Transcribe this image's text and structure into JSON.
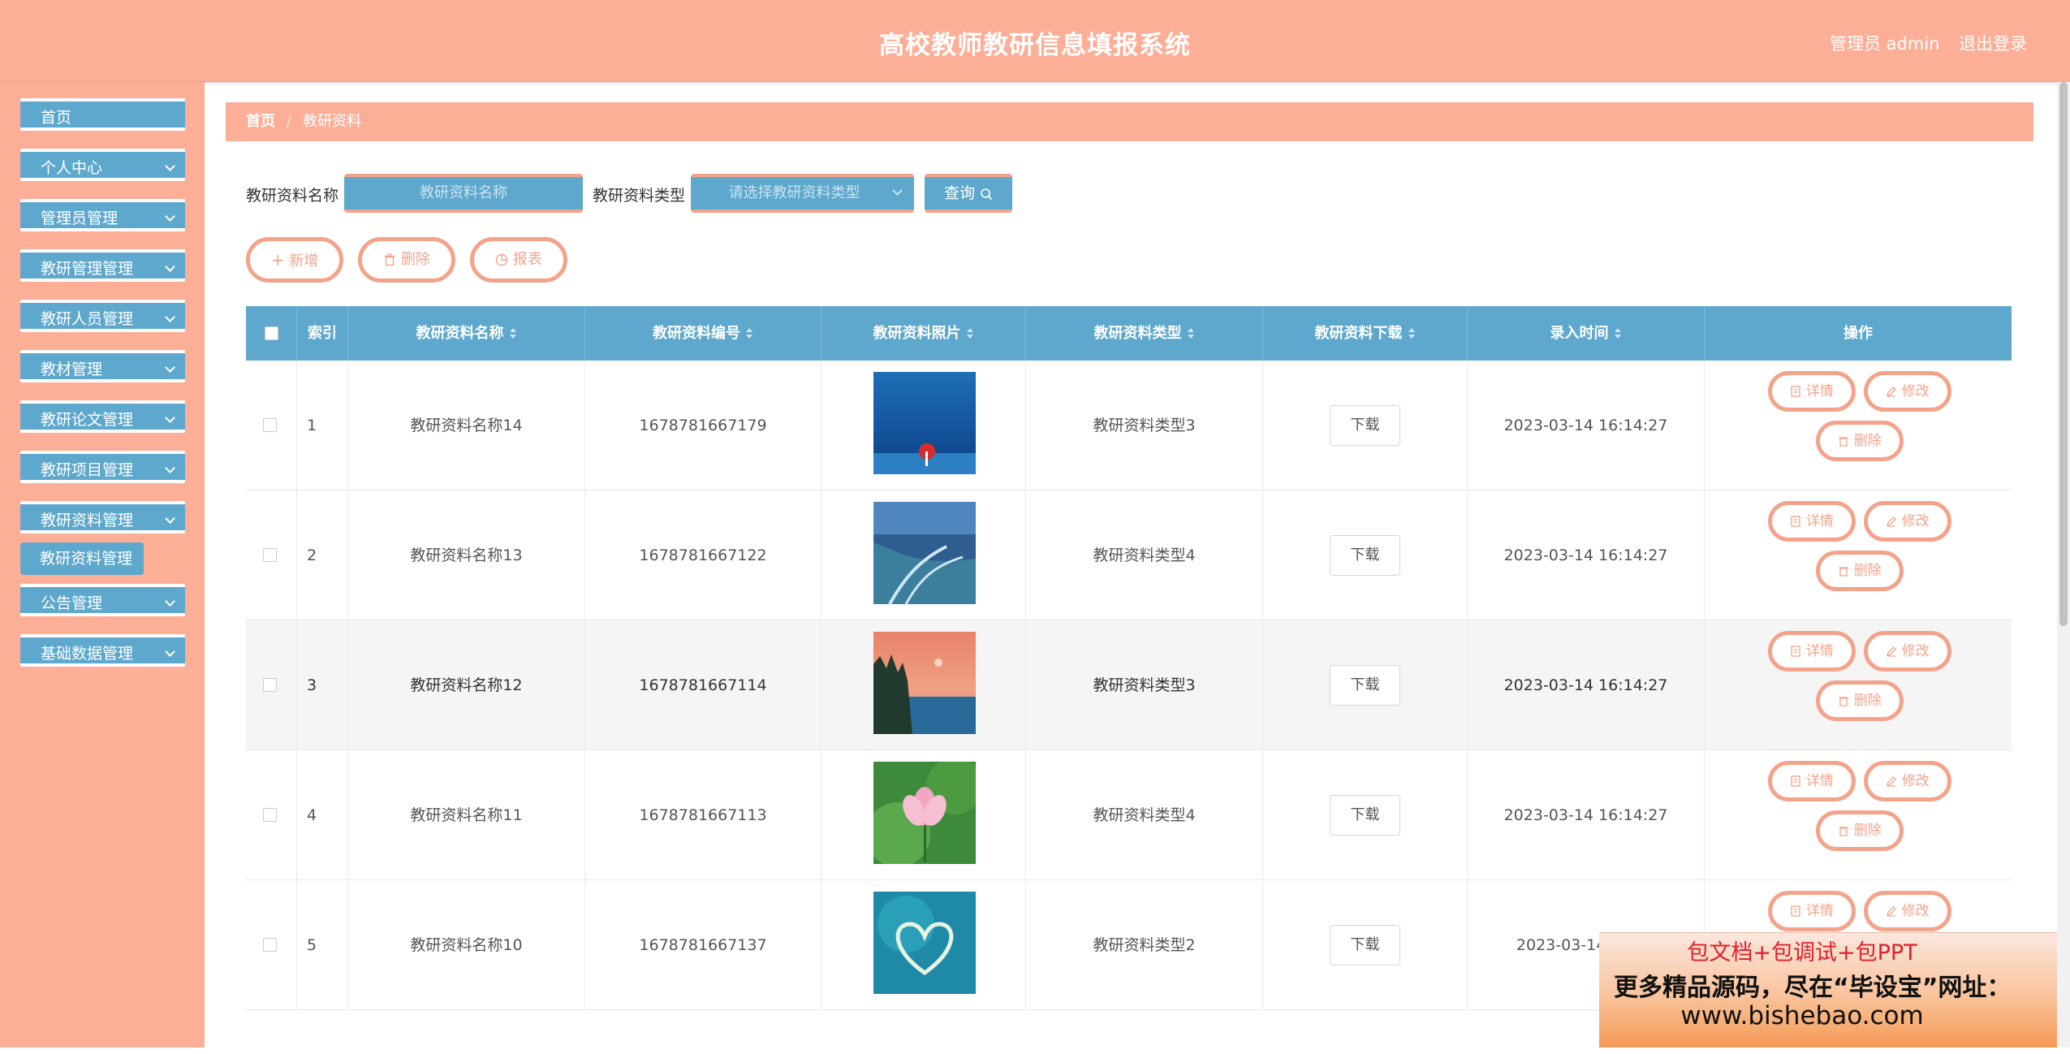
{
  "header": {
    "title": "高校教师教研信息填报系统",
    "user": "管理员 admin",
    "logout": "退出登录"
  },
  "sidebar": {
    "items": [
      {
        "label": "首页"
      },
      {
        "label": "个人中心"
      },
      {
        "label": "管理员管理"
      },
      {
        "label": "教研管理管理"
      },
      {
        "label": "教研人员管理"
      },
      {
        "label": "教材管理"
      },
      {
        "label": "教研论文管理"
      },
      {
        "label": "教研项目管理"
      },
      {
        "label": "教研资料管理"
      },
      {
        "label": "公告管理"
      },
      {
        "label": "基础数据管理"
      }
    ],
    "submenu_active": "教研资料管理"
  },
  "breadcrumb": {
    "home": "首页",
    "current": "教研资料"
  },
  "search": {
    "name_label": "教研资料名称",
    "name_placeholder": "教研资料名称",
    "type_label": "教研资料类型",
    "type_placeholder": "请选择教研资料类型",
    "query_label": "查询"
  },
  "actions": {
    "add": "新增",
    "delete": "删除",
    "report": "报表"
  },
  "table": {
    "columns": [
      "索引",
      "教研资料名称",
      "教研资料编号",
      "教研资料照片",
      "教研资料类型",
      "教研资料下载",
      "录入时间",
      "操作"
    ],
    "download_label": "下载",
    "op_detail": "详情",
    "op_edit": "修改",
    "op_delete": "删除",
    "rows": [
      {
        "index": "1",
        "name": "教研资料名称14",
        "code": "1678781667179",
        "type": "教研资料类型3",
        "time": "2023-03-14 16:14:27",
        "photo": "ocean-red-umbrella"
      },
      {
        "index": "2",
        "name": "教研资料名称13",
        "code": "1678781667122",
        "type": "教研资料类型4",
        "time": "2023-03-14 16:14:27",
        "photo": "river-delta"
      },
      {
        "index": "3",
        "name": "教研资料名称12",
        "code": "1678781667114",
        "type": "教研资料类型3",
        "time": "2023-03-14 16:14:27",
        "photo": "sunset-forest"
      },
      {
        "index": "4",
        "name": "教研资料名称11",
        "code": "1678781667113",
        "type": "教研资料类型4",
        "time": "2023-03-14 16:14:27",
        "photo": "lotus-flower"
      },
      {
        "index": "5",
        "name": "教研资料名称10",
        "code": "1678781667137",
        "type": "教研资料类型2",
        "time": "2023-03-14 16:14",
        "photo": "heart-island"
      }
    ]
  },
  "promo": {
    "line1": "包文档+包调试+包PPT",
    "line2": "更多精品源码，尽在“毕设宝”网址：",
    "line3": "www.bishebao.com"
  },
  "colors": {
    "header": "#fdae96",
    "menu": "#5ea8cd",
    "accent": "#f4a38b"
  }
}
